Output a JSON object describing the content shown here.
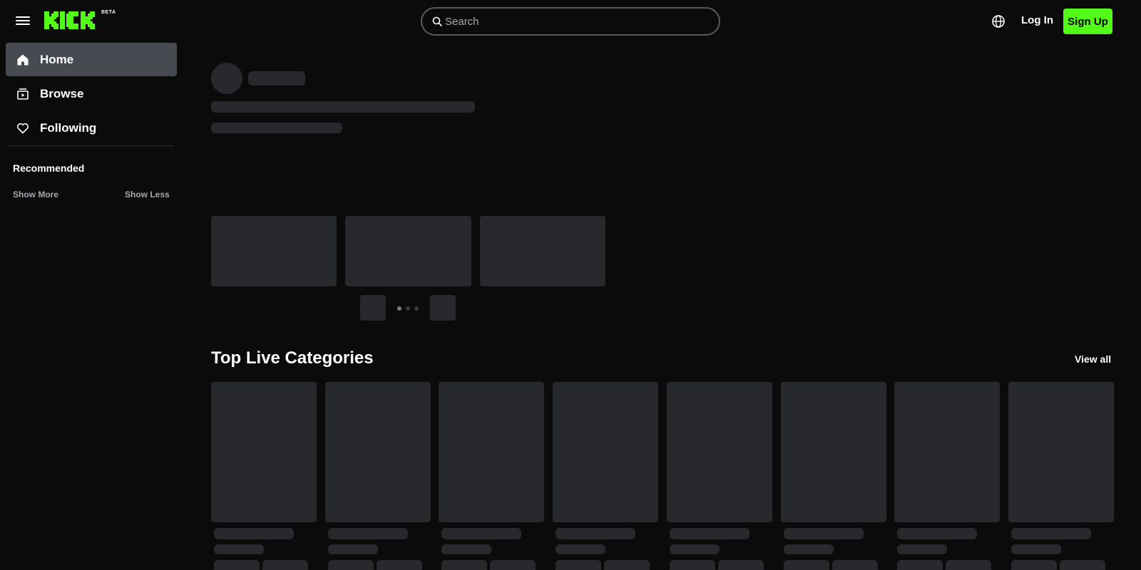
{
  "header": {
    "logo_text": "KICK",
    "beta_badge": "BETA",
    "search_placeholder": "Search",
    "login_label": "Log In",
    "signup_label": "Sign Up"
  },
  "sidebar": {
    "items": [
      {
        "label": "Home",
        "icon": "home-icon",
        "active": true
      },
      {
        "label": "Browse",
        "icon": "browse-icon",
        "active": false
      },
      {
        "label": "Following",
        "icon": "heart-icon",
        "active": false
      }
    ],
    "recommended_title": "Recommended",
    "show_more": "Show More",
    "show_less": "Show Less"
  },
  "main": {
    "top_live_categories_title": "Top Live Categories",
    "view_all_label": "View all"
  },
  "colors": {
    "background": "#0b0b0c",
    "accent": "#53fc18",
    "skeleton": "#28292d",
    "active_nav": "#474a50"
  }
}
